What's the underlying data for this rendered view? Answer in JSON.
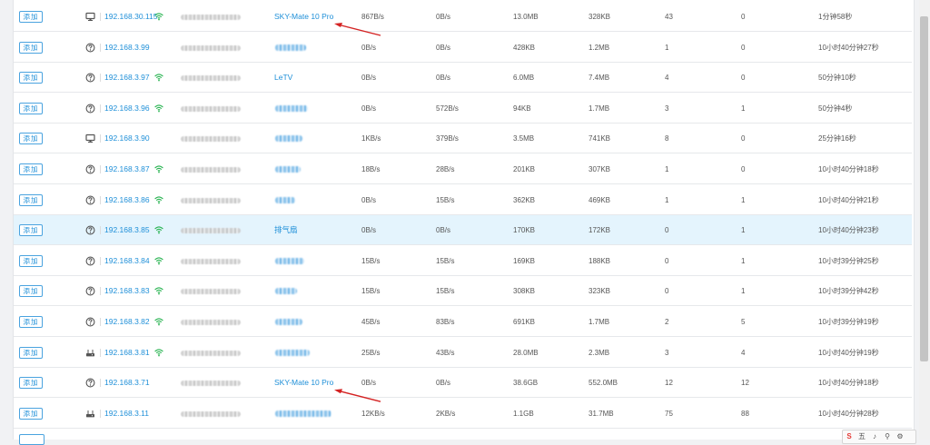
{
  "add_label": "添加",
  "colors": {
    "accent": "#1e8fd8",
    "wifi": "#22b14c",
    "arrow": "#d42222",
    "highlight": "#e4f4fd"
  },
  "rows": [
    {
      "icon": "monitor-icon",
      "ip": "192.168.30.115",
      "wifi": true,
      "name": "SKY-Mate 10 Pro",
      "name_blurred": false,
      "up": "867B/s",
      "down": "0B/s",
      "total_up": "13.0MB",
      "total_down": "328KB",
      "conn1": "43",
      "conn2": "0",
      "online": "1分钟58秒",
      "arrow": true
    },
    {
      "icon": "question-icon",
      "ip": "192.168.3.99",
      "wifi": false,
      "name": "",
      "name_blurred": true,
      "up": "0B/s",
      "down": "0B/s",
      "total_up": "428KB",
      "total_down": "1.2MB",
      "conn1": "1",
      "conn2": "0",
      "online": "10小时40分钟27秒"
    },
    {
      "icon": "question-icon",
      "ip": "192.168.3.97",
      "wifi": true,
      "name": "LeTV",
      "name_blurred": false,
      "up": "0B/s",
      "down": "0B/s",
      "total_up": "6.0MB",
      "total_down": "7.4MB",
      "conn1": "4",
      "conn2": "0",
      "online": "50分钟10秒"
    },
    {
      "icon": "question-icon",
      "ip": "192.168.3.96",
      "wifi": true,
      "name": "",
      "name_blurred": true,
      "up": "0B/s",
      "down": "572B/s",
      "total_up": "94KB",
      "total_down": "1.7MB",
      "conn1": "3",
      "conn2": "1",
      "online": "50分钟4秒"
    },
    {
      "icon": "monitor-icon",
      "ip": "192.168.3.90",
      "wifi": false,
      "name": "",
      "name_blurred": true,
      "up": "1KB/s",
      "down": "379B/s",
      "total_up": "3.5MB",
      "total_down": "741KB",
      "conn1": "8",
      "conn2": "0",
      "online": "25分钟16秒"
    },
    {
      "icon": "question-icon",
      "ip": "192.168.3.87",
      "wifi": true,
      "name": "",
      "name_blurred": true,
      "up": "18B/s",
      "down": "28B/s",
      "total_up": "201KB",
      "total_down": "307KB",
      "conn1": "1",
      "conn2": "0",
      "online": "10小时40分钟18秒"
    },
    {
      "icon": "question-icon",
      "ip": "192.168.3.86",
      "wifi": true,
      "name": "",
      "name_blurred": true,
      "up": "0B/s",
      "down": "15B/s",
      "total_up": "362KB",
      "total_down": "469KB",
      "conn1": "1",
      "conn2": "1",
      "online": "10小时40分钟21秒"
    },
    {
      "icon": "question-icon",
      "ip": "192.168.3.85",
      "wifi": true,
      "name": "排气扇",
      "name_blurred": false,
      "up": "0B/s",
      "down": "0B/s",
      "total_up": "170KB",
      "total_down": "172KB",
      "conn1": "0",
      "conn2": "1",
      "online": "10小时40分钟23秒",
      "highlight": true
    },
    {
      "icon": "question-icon",
      "ip": "192.168.3.84",
      "wifi": true,
      "name": "",
      "name_blurred": true,
      "up": "15B/s",
      "down": "15B/s",
      "total_up": "169KB",
      "total_down": "188KB",
      "conn1": "0",
      "conn2": "1",
      "online": "10小时39分钟25秒"
    },
    {
      "icon": "question-icon",
      "ip": "192.168.3.83",
      "wifi": true,
      "name": "",
      "name_blurred": true,
      "up": "15B/s",
      "down": "15B/s",
      "total_up": "308KB",
      "total_down": "323KB",
      "conn1": "0",
      "conn2": "1",
      "online": "10小时39分钟42秒"
    },
    {
      "icon": "question-icon",
      "ip": "192.168.3.82",
      "wifi": true,
      "name": "",
      "name_blurred": true,
      "up": "45B/s",
      "down": "83B/s",
      "total_up": "691KB",
      "total_down": "1.7MB",
      "conn1": "2",
      "conn2": "5",
      "online": "10小时39分钟19秒"
    },
    {
      "icon": "router-icon",
      "ip": "192.168.3.81",
      "wifi": true,
      "name": "",
      "name_blurred": true,
      "up": "25B/s",
      "down": "43B/s",
      "total_up": "28.0MB",
      "total_down": "2.3MB",
      "conn1": "3",
      "conn2": "4",
      "online": "10小时40分钟19秒"
    },
    {
      "icon": "question-icon",
      "ip": "192.168.3.71",
      "wifi": false,
      "name": "SKY-Mate 10 Pro",
      "name_blurred": false,
      "up": "0B/s",
      "down": "0B/s",
      "total_up": "38.6GB",
      "total_down": "552.0MB",
      "conn1": "12",
      "conn2": "12",
      "online": "10小时40分钟18秒",
      "arrow": true
    },
    {
      "icon": "router-icon",
      "ip": "192.168.3.11",
      "wifi": false,
      "name": "",
      "name_blurred": true,
      "up": "12KB/s",
      "down": "2KB/s",
      "total_up": "1.1GB",
      "total_down": "31.7MB",
      "conn1": "75",
      "conn2": "88",
      "online": "10小时40分钟28秒"
    }
  ],
  "float_toolbar": {
    "items": [
      "S",
      "五",
      "♪",
      "⚲",
      "⚙"
    ]
  }
}
